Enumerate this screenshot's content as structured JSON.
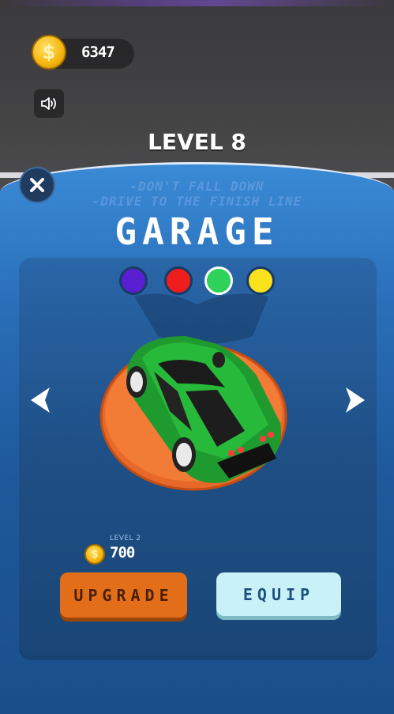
{
  "hud": {
    "coins": "6347",
    "coin_symbol": "$",
    "level_title": "LEVEL 8"
  },
  "background_hint": {
    "line1": "-DON'T FALL DOWN",
    "line2": "-DRIVE TO THE FINISH LINE"
  },
  "garage": {
    "title": "GARAGE",
    "colors": [
      {
        "name": "purple",
        "hex": "#5a1fd1",
        "selected": false
      },
      {
        "name": "red",
        "hex": "#ef1d1d",
        "selected": false
      },
      {
        "name": "green",
        "hex": "#2ed15a",
        "selected": true
      },
      {
        "name": "yellow",
        "hex": "#f7e21b",
        "selected": false
      }
    ],
    "upgrade_level_label": "LEVEL 2",
    "upgrade_cost": "700",
    "upgrade_label": "UPGRADE",
    "equip_label": "EQUIP"
  },
  "icons": {
    "coin": "coin-icon",
    "sound": "speaker-icon",
    "close": "close-icon",
    "prev": "arrow-left-icon",
    "next": "arrow-right-icon"
  }
}
